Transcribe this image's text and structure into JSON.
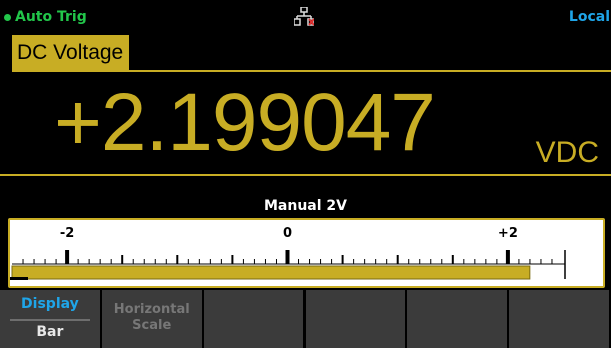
{
  "status": {
    "trigger": "Auto Trig",
    "remote": "Local",
    "lan_icon": "lan-network-icon",
    "trigger_color": "#22c64a",
    "remote_color": "#1fa5e8"
  },
  "measurement": {
    "function": "DC Voltage",
    "value": "+2.199047",
    "unit": "VDC",
    "accent_color": "#c8ad24"
  },
  "bar_graph": {
    "range_label": "Manual 2V",
    "scale_min": -2.5,
    "scale_max": 2.5,
    "major_ticks": [
      {
        "value": -2,
        "label": "-2"
      },
      {
        "value": 0,
        "label": "0"
      },
      {
        "value": 2,
        "label": "+2"
      }
    ],
    "minor_step": 0.1,
    "reading": 2.199047
  },
  "softkeys": [
    {
      "top": "Display",
      "bottom": "Bar",
      "active": true
    },
    {
      "line1": "Horizontal",
      "line2": "Scale",
      "active": false
    },
    {
      "active": false
    },
    {
      "active": false
    },
    {
      "active": false
    },
    {
      "active": false
    }
  ]
}
